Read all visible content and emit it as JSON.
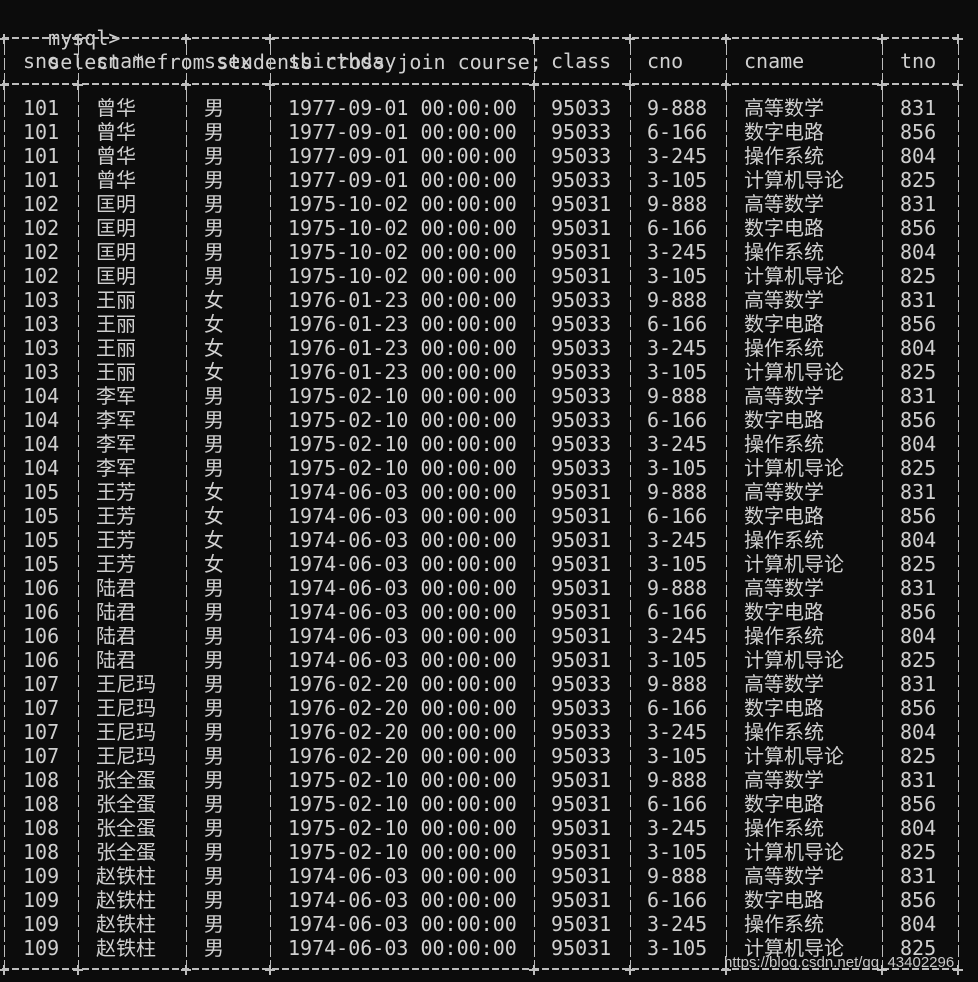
{
  "terminal": {
    "prompt": "mysql>",
    "command": "select * from students cross join course;"
  },
  "table": {
    "headers": [
      "sno",
      "sname",
      "ssex",
      "sbirthday",
      "class",
      "cno",
      "cname",
      "tno"
    ],
    "rows": [
      [
        "101",
        "曾华",
        "男",
        "1977-09-01 00:00:00",
        "95033",
        "9-888",
        "高等数学",
        "831"
      ],
      [
        "101",
        "曾华",
        "男",
        "1977-09-01 00:00:00",
        "95033",
        "6-166",
        "数字电路",
        "856"
      ],
      [
        "101",
        "曾华",
        "男",
        "1977-09-01 00:00:00",
        "95033",
        "3-245",
        "操作系统",
        "804"
      ],
      [
        "101",
        "曾华",
        "男",
        "1977-09-01 00:00:00",
        "95033",
        "3-105",
        "计算机导论",
        "825"
      ],
      [
        "102",
        "匡明",
        "男",
        "1975-10-02 00:00:00",
        "95031",
        "9-888",
        "高等数学",
        "831"
      ],
      [
        "102",
        "匡明",
        "男",
        "1975-10-02 00:00:00",
        "95031",
        "6-166",
        "数字电路",
        "856"
      ],
      [
        "102",
        "匡明",
        "男",
        "1975-10-02 00:00:00",
        "95031",
        "3-245",
        "操作系统",
        "804"
      ],
      [
        "102",
        "匡明",
        "男",
        "1975-10-02 00:00:00",
        "95031",
        "3-105",
        "计算机导论",
        "825"
      ],
      [
        "103",
        "王丽",
        "女",
        "1976-01-23 00:00:00",
        "95033",
        "9-888",
        "高等数学",
        "831"
      ],
      [
        "103",
        "王丽",
        "女",
        "1976-01-23 00:00:00",
        "95033",
        "6-166",
        "数字电路",
        "856"
      ],
      [
        "103",
        "王丽",
        "女",
        "1976-01-23 00:00:00",
        "95033",
        "3-245",
        "操作系统",
        "804"
      ],
      [
        "103",
        "王丽",
        "女",
        "1976-01-23 00:00:00",
        "95033",
        "3-105",
        "计算机导论",
        "825"
      ],
      [
        "104",
        "李军",
        "男",
        "1975-02-10 00:00:00",
        "95033",
        "9-888",
        "高等数学",
        "831"
      ],
      [
        "104",
        "李军",
        "男",
        "1975-02-10 00:00:00",
        "95033",
        "6-166",
        "数字电路",
        "856"
      ],
      [
        "104",
        "李军",
        "男",
        "1975-02-10 00:00:00",
        "95033",
        "3-245",
        "操作系统",
        "804"
      ],
      [
        "104",
        "李军",
        "男",
        "1975-02-10 00:00:00",
        "95033",
        "3-105",
        "计算机导论",
        "825"
      ],
      [
        "105",
        "王芳",
        "女",
        "1974-06-03 00:00:00",
        "95031",
        "9-888",
        "高等数学",
        "831"
      ],
      [
        "105",
        "王芳",
        "女",
        "1974-06-03 00:00:00",
        "95031",
        "6-166",
        "数字电路",
        "856"
      ],
      [
        "105",
        "王芳",
        "女",
        "1974-06-03 00:00:00",
        "95031",
        "3-245",
        "操作系统",
        "804"
      ],
      [
        "105",
        "王芳",
        "女",
        "1974-06-03 00:00:00",
        "95031",
        "3-105",
        "计算机导论",
        "825"
      ],
      [
        "106",
        "陆君",
        "男",
        "1974-06-03 00:00:00",
        "95031",
        "9-888",
        "高等数学",
        "831"
      ],
      [
        "106",
        "陆君",
        "男",
        "1974-06-03 00:00:00",
        "95031",
        "6-166",
        "数字电路",
        "856"
      ],
      [
        "106",
        "陆君",
        "男",
        "1974-06-03 00:00:00",
        "95031",
        "3-245",
        "操作系统",
        "804"
      ],
      [
        "106",
        "陆君",
        "男",
        "1974-06-03 00:00:00",
        "95031",
        "3-105",
        "计算机导论",
        "825"
      ],
      [
        "107",
        "王尼玛",
        "男",
        "1976-02-20 00:00:00",
        "95033",
        "9-888",
        "高等数学",
        "831"
      ],
      [
        "107",
        "王尼玛",
        "男",
        "1976-02-20 00:00:00",
        "95033",
        "6-166",
        "数字电路",
        "856"
      ],
      [
        "107",
        "王尼玛",
        "男",
        "1976-02-20 00:00:00",
        "95033",
        "3-245",
        "操作系统",
        "804"
      ],
      [
        "107",
        "王尼玛",
        "男",
        "1976-02-20 00:00:00",
        "95033",
        "3-105",
        "计算机导论",
        "825"
      ],
      [
        "108",
        "张全蛋",
        "男",
        "1975-02-10 00:00:00",
        "95031",
        "9-888",
        "高等数学",
        "831"
      ],
      [
        "108",
        "张全蛋",
        "男",
        "1975-02-10 00:00:00",
        "95031",
        "6-166",
        "数字电路",
        "856"
      ],
      [
        "108",
        "张全蛋",
        "男",
        "1975-02-10 00:00:00",
        "95031",
        "3-245",
        "操作系统",
        "804"
      ],
      [
        "108",
        "张全蛋",
        "男",
        "1975-02-10 00:00:00",
        "95031",
        "3-105",
        "计算机导论",
        "825"
      ],
      [
        "109",
        "赵铁柱",
        "男",
        "1974-06-03 00:00:00",
        "95031",
        "9-888",
        "高等数学",
        "831"
      ],
      [
        "109",
        "赵铁柱",
        "男",
        "1974-06-03 00:00:00",
        "95031",
        "6-166",
        "数字电路",
        "856"
      ],
      [
        "109",
        "赵铁柱",
        "男",
        "1974-06-03 00:00:00",
        "95031",
        "3-245",
        "操作系统",
        "804"
      ],
      [
        "109",
        "赵铁柱",
        "男",
        "1974-06-03 00:00:00",
        "95031",
        "3-105",
        "计算机导论",
        "825"
      ]
    ]
  },
  "watermark": "https://blog.csdn.net/qq_43402296",
  "colors": {
    "background": "#0c0c0c",
    "text": "#cccccc",
    "border": "#bdbdbd"
  }
}
